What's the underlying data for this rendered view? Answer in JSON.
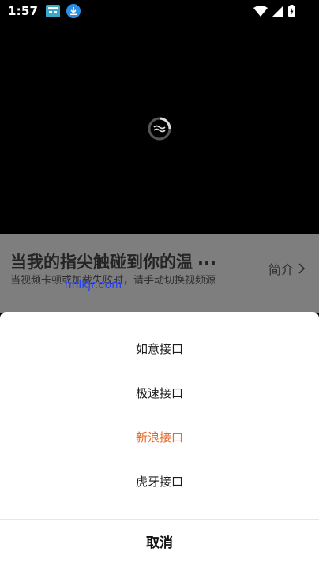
{
  "status_bar": {
    "time": "1:57",
    "icons": [
      "app-notification-icon",
      "download-notification-icon",
      "wifi-icon",
      "cellular-signal-icon",
      "battery-charging-icon"
    ]
  },
  "video": {
    "loading_icon": "loading-spinner-icon"
  },
  "info": {
    "title": "当我的指尖触碰到你的温",
    "title_ellipsis": "...",
    "intro_label": "简介",
    "notice": "当视频卡顿或加载失败时，请手动切换视频源",
    "watermark": "hnlkjr.com"
  },
  "sheet": {
    "options": [
      {
        "label": "如意接口",
        "active": false
      },
      {
        "label": "极速接口",
        "active": false
      },
      {
        "label": "新浪接口",
        "active": true
      },
      {
        "label": "虎牙接口",
        "active": false
      }
    ],
    "cancel_label": "取消"
  },
  "colors": {
    "accent": "#e86a2a",
    "overlay": "#7e7e7e"
  }
}
